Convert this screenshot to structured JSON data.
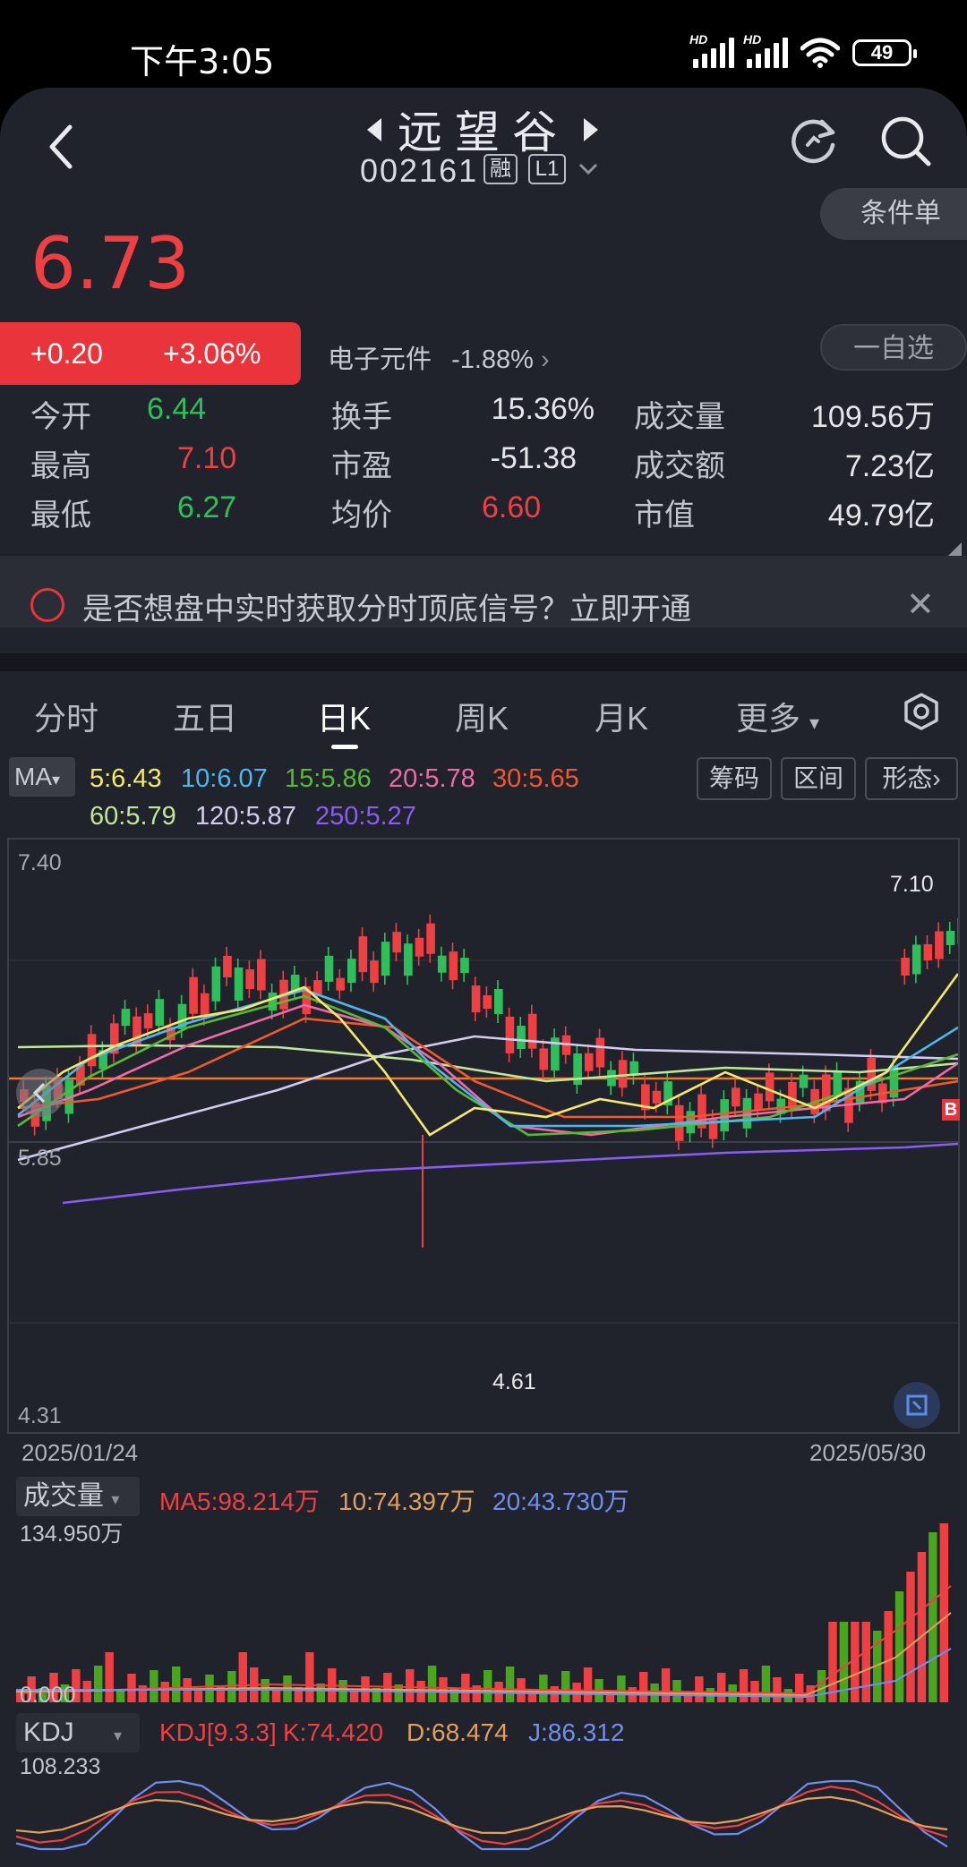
{
  "status_bar": {
    "time": "下午3:05",
    "battery": "49",
    "net_label": "HD"
  },
  "header": {
    "stock_name": "远望谷",
    "stock_code": "002161",
    "tags": [
      "融",
      "L1"
    ]
  },
  "quote": {
    "price": "6.73",
    "change": "+0.20",
    "change_pct": "+3.06%",
    "sector_name": "电子元件",
    "sector_change": "-1.88%",
    "condition_order_label": "条件单",
    "watchlist_label": "一自选"
  },
  "stats": [
    [
      {
        "label": "今开",
        "value": "6.44",
        "tone": "down"
      },
      {
        "label": "换手",
        "value": "15.36%",
        "tone": "neu"
      },
      {
        "label": "成交量",
        "value": "109.56万",
        "tone": "neu"
      }
    ],
    [
      {
        "label": "最高",
        "value": "7.10",
        "tone": "up"
      },
      {
        "label": "市盈",
        "value": "-51.38",
        "tone": "neu"
      },
      {
        "label": "成交额",
        "value": "7.23亿",
        "tone": "neu"
      }
    ],
    [
      {
        "label": "最低",
        "value": "6.27",
        "tone": "down"
      },
      {
        "label": "均价",
        "value": "6.60",
        "tone": "up"
      },
      {
        "label": "市值",
        "value": "49.79亿",
        "tone": "neu"
      }
    ]
  ],
  "notice": {
    "text": "是否想盘中实时获取分时顶底信号？立即开通"
  },
  "tabs": [
    "分时",
    "五日",
    "日K",
    "周K",
    "月K",
    "更多"
  ],
  "active_tab": "日K",
  "ma_legend": {
    "selector": "MA",
    "items": [
      {
        "text": "5:6.43",
        "color": "#f5e86a"
      },
      {
        "text": "10:6.07",
        "color": "#4fb6f0"
      },
      {
        "text": "15:5.86",
        "color": "#59b935"
      },
      {
        "text": "20:5.78",
        "color": "#f06aa8"
      },
      {
        "text": "30:5.65",
        "color": "#f2582c"
      },
      {
        "text": "60:5.79",
        "color": "#bfe69a"
      },
      {
        "text": "120:5.87",
        "color": "#d2cdf0"
      },
      {
        "text": "250:5.27",
        "color": "#8a5cf0"
      }
    ],
    "buttons": [
      "筹码",
      "区间",
      "形态"
    ]
  },
  "kline": {
    "y_max_label": "7.40",
    "y_mid_label": "5.85",
    "y_min_label": "4.31",
    "high_marker": "7.10",
    "low_marker": "4.61",
    "date_start": "2025/01/24",
    "date_end": "2025/05/30",
    "buy_marker": "B"
  },
  "volume": {
    "selector": "成交量",
    "ma5": "MA5:98.214万",
    "ma10": "10:74.397万",
    "ma20": "20:43.730万",
    "max_label": "134.950万",
    "zero_label": "0.000"
  },
  "kdj": {
    "selector": "KDJ",
    "params": "KDJ[9.3.3]",
    "k": "K:74.420",
    "d": "D:68.474",
    "j": "J:86.312",
    "max_label": "108.233"
  },
  "colors": {
    "up": "#ee4042",
    "down": "#2fbf5a",
    "bg": "#20232b",
    "resistance_line": "#f07a2a"
  }
}
